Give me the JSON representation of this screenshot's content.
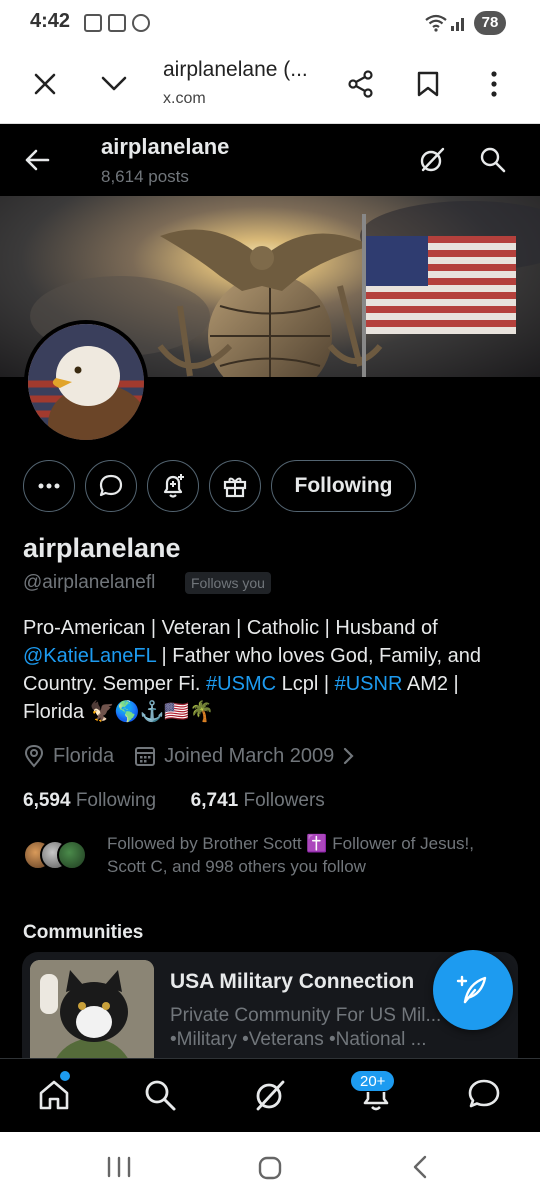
{
  "status_bar": {
    "time": "4:42",
    "battery": "78"
  },
  "browser": {
    "page_title": "airplanelane (...",
    "url": "x.com"
  },
  "profile_header": {
    "name": "airplanelane",
    "posts": "8,614 posts"
  },
  "profile": {
    "display_name": "airplanelane",
    "handle": "@airplanelanefl",
    "follows_you": "Follows you",
    "following_button": "Following",
    "bio": {
      "part1": "Pro-American | Veteran | Catholic | Husband of ",
      "mention": "@KatieLaneFL",
      "part2": " | Father who loves God, Family, and Country. Semper Fi. ",
      "hashtag1": "#USMC",
      "part3": " Lcpl | ",
      "hashtag2": "#USNR",
      "part4": " AM2 | Florida ",
      "emojis": "🦅🌎⚓🇺🇸🌴"
    },
    "location": "Florida",
    "joined": "Joined March 2009",
    "following_count": "6,594",
    "following_label": "Following",
    "followers_count": "6,741",
    "followers_label": "Followers",
    "followed_by": "Followed by Brother Scott ✝️ Follower of Jesus!, Scott C, and 998 others you follow"
  },
  "communities": {
    "heading": "Communities",
    "items": [
      {
        "name": "USA Military Connection",
        "description": "Private Community For US Mil... Only •Military •Veterans •National ..."
      }
    ]
  },
  "bottom_nav": {
    "notification_badge": "20+"
  },
  "colors": {
    "accent": "#1d9bf0",
    "background": "#000000",
    "muted_text": "#71767b"
  }
}
